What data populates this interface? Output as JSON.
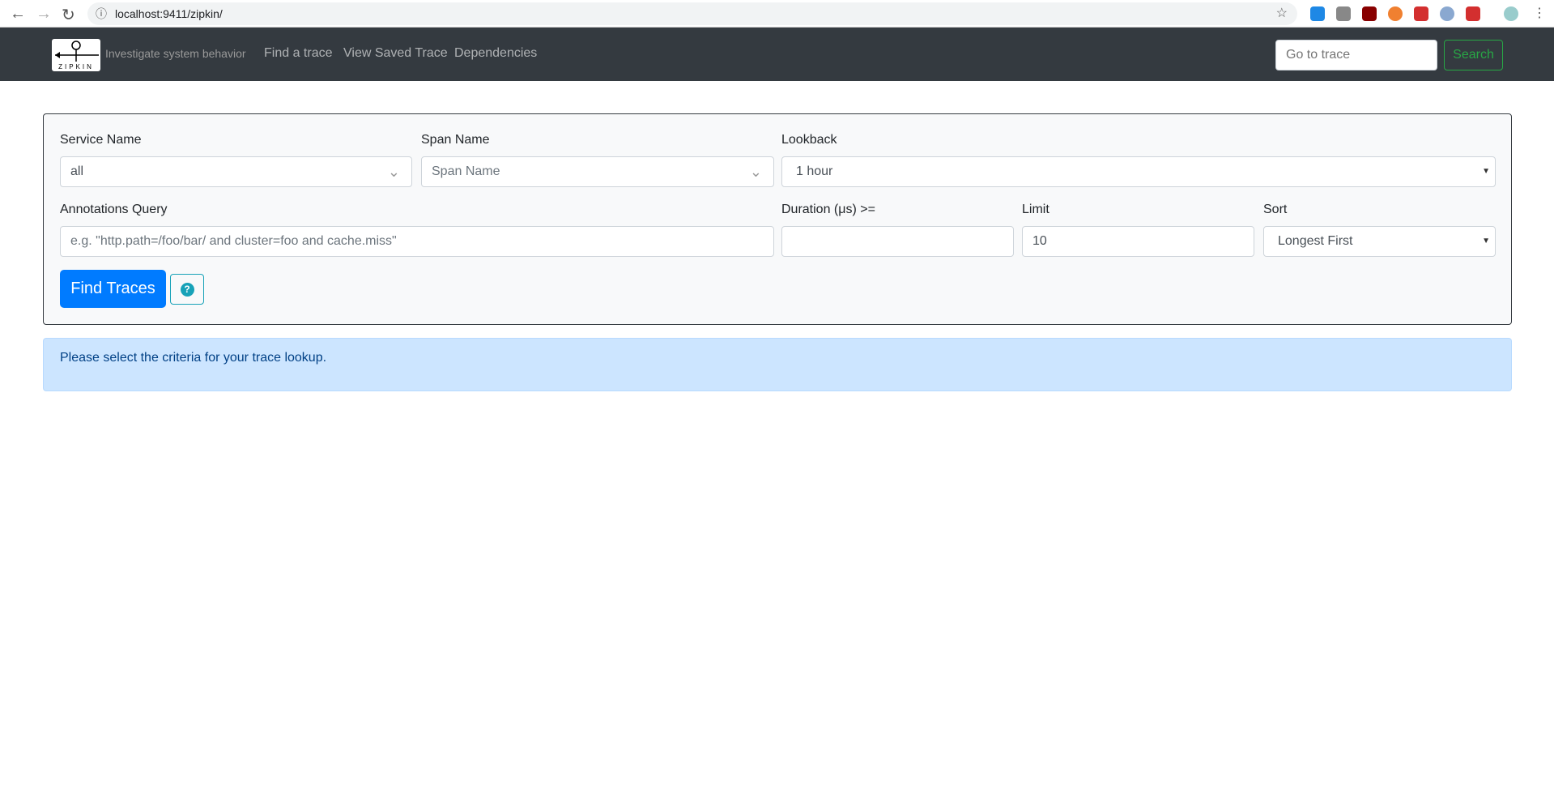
{
  "browser": {
    "url": "localhost:9411/zipkin/"
  },
  "navbar": {
    "logo_text": "ZIPKIN",
    "tagline": "Investigate system behavior",
    "links": [
      "Find a trace",
      "View Saved Trace",
      "Dependencies"
    ],
    "goto_placeholder": "Go to trace",
    "search_label": "Search"
  },
  "form": {
    "service_label": "Service Name",
    "service_value": "all",
    "span_label": "Span Name",
    "span_placeholder": "Span Name",
    "lookback_label": "Lookback",
    "lookback_value": "1 hour",
    "annotations_label": "Annotations Query",
    "annotations_placeholder": "e.g. \"http.path=/foo/bar/ and cluster=foo and cache.miss\"",
    "duration_label": "Duration (μs) >=",
    "duration_value": "",
    "limit_label": "Limit",
    "limit_value": "10",
    "sort_label": "Sort",
    "sort_value": "Longest First",
    "find_label": "Find Traces",
    "help_icon": "?"
  },
  "alert": {
    "message": "Please select the criteria for your trace lookup."
  },
  "colors": {
    "navbar": "#343a40",
    "primary": "#007bff",
    "success": "#28a745",
    "info": "#17a2b8",
    "alert_bg": "#cce5ff"
  }
}
